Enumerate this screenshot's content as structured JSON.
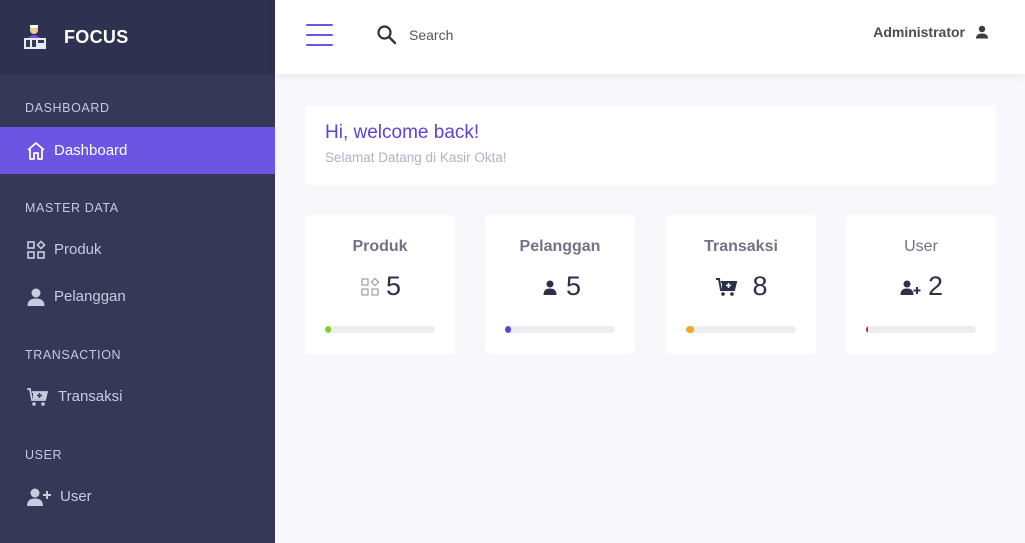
{
  "brand": {
    "name": "FOCUS",
    "logo_icon": "cashier-icon"
  },
  "sidebar": {
    "sections": [
      {
        "title": "DASHBOARD"
      },
      {
        "title": "MASTER DATA"
      },
      {
        "title": "TRANSACTION"
      },
      {
        "title": "USER"
      }
    ],
    "items": [
      {
        "label": "Dashboard",
        "icon": "home-icon",
        "active": true
      },
      {
        "label": "Produk",
        "icon": "grid-icon"
      },
      {
        "label": "Pelanggan",
        "icon": "person-icon"
      },
      {
        "label": "Transaksi",
        "icon": "cart-icon"
      },
      {
        "label": "User",
        "icon": "user-add-icon"
      }
    ]
  },
  "header": {
    "search_placeholder": "Search",
    "user_name": "Administrator"
  },
  "welcome": {
    "title": "Hi, welcome back!",
    "subtitle": "Selamat Datang di Kasir Okta!"
  },
  "stats": [
    {
      "title": "Produk",
      "value": "5",
      "icon": "grid-icon",
      "color": "#7ed321",
      "progress": 0.05
    },
    {
      "title": "Pelanggan",
      "value": "5",
      "icon": "person-icon",
      "color": "#5b45d4",
      "progress": 0.05
    },
    {
      "title": "Transaksi",
      "value": "8",
      "icon": "cart-icon",
      "color": "#f5a623",
      "progress": 0.07
    },
    {
      "title": "User",
      "value": "2",
      "icon": "user-add-icon",
      "color": "#e02020",
      "progress": 0.02
    }
  ],
  "colors": {
    "accent": "#6c55e3",
    "sidebar_bg": "#363857"
  }
}
